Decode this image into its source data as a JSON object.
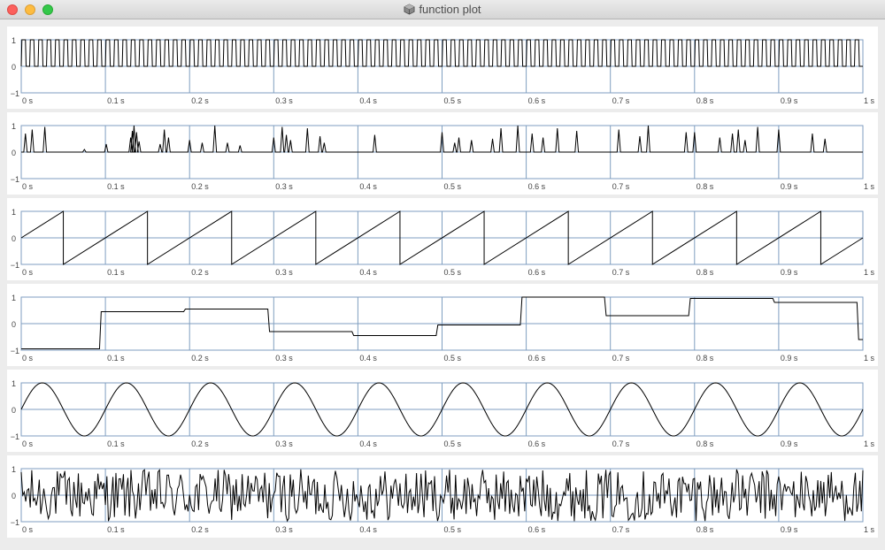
{
  "window": {
    "title": "function plot",
    "icon": "cube-app-icon"
  },
  "chart_data": [
    {
      "type": "line",
      "function": "square",
      "xlim": [
        0,
        1
      ],
      "ylim": [
        -1,
        1
      ],
      "x_ticks": [
        "0 s",
        "0.1 s",
        "0.2 s",
        "0.3 s",
        "0.4 s",
        "0.5 s",
        "0.6 s",
        "0.7 s",
        "0.8 s",
        "0.9 s",
        "1 s"
      ],
      "y_ticks": [
        "1",
        "0",
        "−1"
      ],
      "frequency_hz": 100,
      "series": [
        {
          "values": [
            1,
            0,
            1,
            0,
            1,
            0,
            1,
            0,
            1,
            0
          ]
        }
      ]
    },
    {
      "type": "line",
      "function": "sparse spikes",
      "xlim": [
        0,
        1
      ],
      "ylim": [
        -1,
        1
      ],
      "x_ticks": [
        "0 s",
        "0.1 s",
        "0.2 s",
        "0.3 s",
        "0.4 s",
        "0.5 s",
        "0.6 s",
        "0.7 s",
        "0.8 s",
        "0.9 s",
        "1 s"
      ],
      "y_ticks": [
        "1",
        "0",
        "−1"
      ],
      "series": [
        {
          "x": [
            0.005,
            0.013,
            0.028,
            0.075,
            0.101,
            0.13,
            0.132,
            0.134,
            0.137,
            0.14,
            0.165,
            0.17,
            0.175,
            0.2,
            0.215,
            0.23,
            0.245,
            0.26,
            0.3,
            0.31,
            0.315,
            0.32,
            0.34,
            0.355,
            0.36,
            0.42,
            0.5,
            0.515,
            0.52,
            0.535,
            0.56,
            0.57,
            0.59,
            0.607,
            0.62,
            0.637,
            0.66,
            0.71,
            0.735,
            0.745,
            0.79,
            0.8,
            0.83,
            0.845,
            0.852,
            0.86,
            0.875,
            0.9,
            0.94,
            0.955
          ],
          "values": [
            0.7,
            0.85,
            0.95,
            0.1,
            0.3,
            0.55,
            0.8,
            1.0,
            0.75,
            0.4,
            0.3,
            0.85,
            0.55,
            0.45,
            0.35,
            1.0,
            0.35,
            0.25,
            0.55,
            0.95,
            0.65,
            0.45,
            0.9,
            0.6,
            0.35,
            0.65,
            0.75,
            0.35,
            0.55,
            0.45,
            0.5,
            0.9,
            1.0,
            0.7,
            0.55,
            0.9,
            0.8,
            0.85,
            0.6,
            1.0,
            0.75,
            0.75,
            0.55,
            0.7,
            0.85,
            0.45,
            0.95,
            0.85,
            0.7,
            0.5
          ]
        }
      ]
    },
    {
      "type": "line",
      "function": "sawtooth",
      "xlim": [
        0,
        1
      ],
      "ylim": [
        -1,
        1
      ],
      "x_ticks": [
        "0 s",
        "0.1 s",
        "0.2 s",
        "0.3 s",
        "0.4 s",
        "0.5 s",
        "0.6 s",
        "0.7 s",
        "0.8 s",
        "0.9 s",
        "1 s"
      ],
      "y_ticks": [
        "1",
        "0",
        "−1"
      ],
      "frequency_hz": 10,
      "series": [
        {
          "x": [
            0,
            0.05,
            0.05,
            0.15,
            0.15,
            0.25,
            0.25,
            0.35,
            0.35,
            0.45,
            0.45,
            0.55,
            0.55,
            0.65,
            0.65,
            0.75,
            0.75,
            0.85,
            0.85,
            0.95,
            0.95,
            1
          ],
          "values": [
            0,
            1,
            -1,
            1,
            -1,
            1,
            -1,
            1,
            -1,
            1,
            -1,
            1,
            -1,
            1,
            -1,
            1,
            -1,
            1,
            -1,
            1,
            -1,
            0
          ]
        }
      ]
    },
    {
      "type": "line",
      "function": "sample and hold",
      "xlim": [
        0,
        1
      ],
      "ylim": [
        -1,
        1
      ],
      "x_ticks": [
        "0 s",
        "0.1 s",
        "0.2 s",
        "0.3 s",
        "0.4 s",
        "0.5 s",
        "0.6 s",
        "0.7 s",
        "0.8 s",
        "0.9 s",
        "1 s"
      ],
      "y_ticks": [
        "1",
        "0",
        "−1"
      ],
      "series": [
        {
          "x": [
            0,
            0.1,
            0.2,
            0.3,
            0.4,
            0.5,
            0.6,
            0.7,
            0.8,
            0.9,
            1.0
          ],
          "values": [
            -0.95,
            0.45,
            0.55,
            -0.3,
            -0.45,
            -0.05,
            1.0,
            0.3,
            0.95,
            0.8,
            -0.6
          ]
        }
      ]
    },
    {
      "type": "line",
      "function": "sine",
      "xlim": [
        0,
        1
      ],
      "ylim": [
        -1,
        1
      ],
      "x_ticks": [
        "0 s",
        "0.1 s",
        "0.2 s",
        "0.3 s",
        "0.4 s",
        "0.5 s",
        "0.6 s",
        "0.7 s",
        "0.8 s",
        "0.9 s",
        "1 s"
      ],
      "y_ticks": [
        "1",
        "0",
        "−1"
      ],
      "frequency_hz": 10,
      "series": [
        {
          "values": [
            0,
            1,
            0,
            -1,
            0
          ]
        }
      ]
    },
    {
      "type": "line",
      "function": "white noise",
      "xlim": [
        0,
        1
      ],
      "ylim": [
        -1,
        1
      ],
      "x_ticks": [
        "0 s",
        "0.1 s",
        "0.2 s",
        "0.3 s",
        "0.4 s",
        "0.5 s",
        "0.6 s",
        "0.7 s",
        "0.8 s",
        "0.9 s",
        "1 s"
      ],
      "y_ticks": [
        "1",
        "0",
        "−1"
      ],
      "series": [
        {
          "values": [
            0.4,
            -0.8,
            0.9,
            -0.3,
            0.6,
            -0.95,
            0.2,
            0.85,
            -0.6,
            0.1
          ]
        }
      ]
    }
  ],
  "style": {
    "grid_color": "#7f9ec0",
    "line_color": "#000000",
    "panel_color": "#ffffff",
    "background_color": "#ececec",
    "tick_label_color": "#444444"
  }
}
